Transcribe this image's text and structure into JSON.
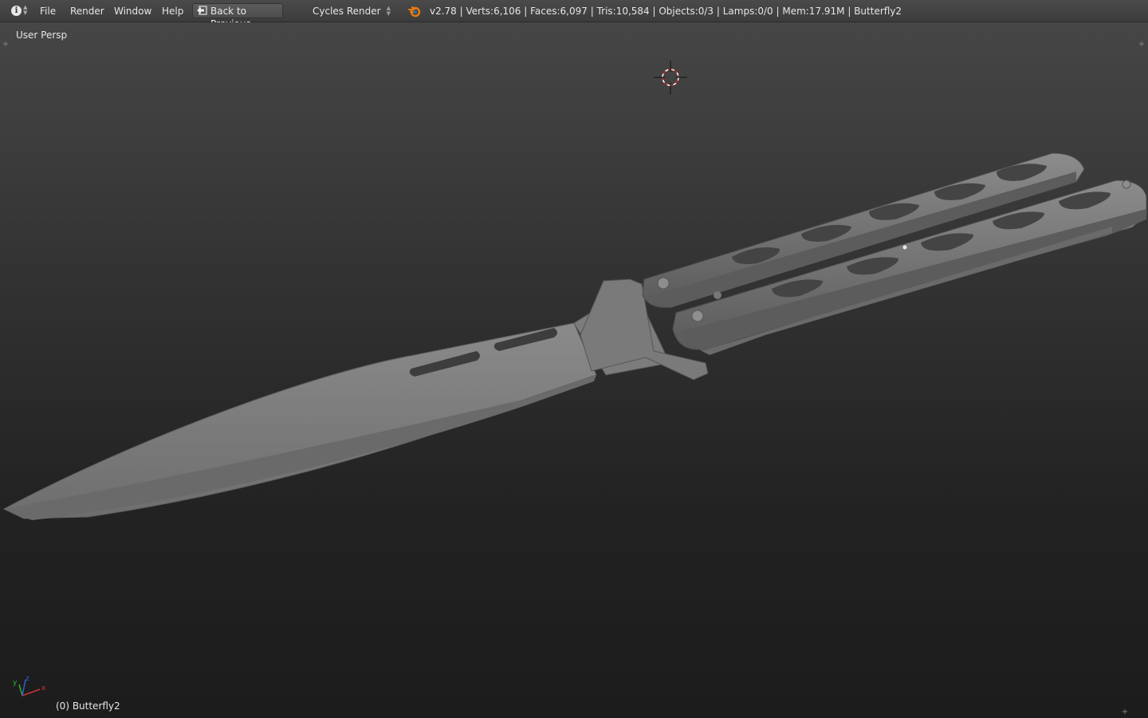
{
  "topbar": {
    "menu": [
      "File",
      "Render",
      "Window",
      "Help"
    ],
    "back_label": "Back to Previous",
    "engine": "Cycles Render",
    "stats": "v2.78 | Verts:6,106 | Faces:6,097 | Tris:10,584 | Objects:0/3 | Lamps:0/0 | Mem:17.91M | Butterfly2"
  },
  "viewport": {
    "view_label": "User Persp",
    "object_label": "(0) Butterfly2",
    "axes": {
      "x": "x",
      "y": "y",
      "z": "z"
    }
  },
  "colors": {
    "accent": "#e87d0d",
    "cursor_red": "#d02020",
    "mesh_gray": "#7a7a7a"
  },
  "icons": [
    "info-icon",
    "back-arrow-icon",
    "blender-logo-icon",
    "3d-cursor-icon",
    "axis-gizmo-icon"
  ]
}
